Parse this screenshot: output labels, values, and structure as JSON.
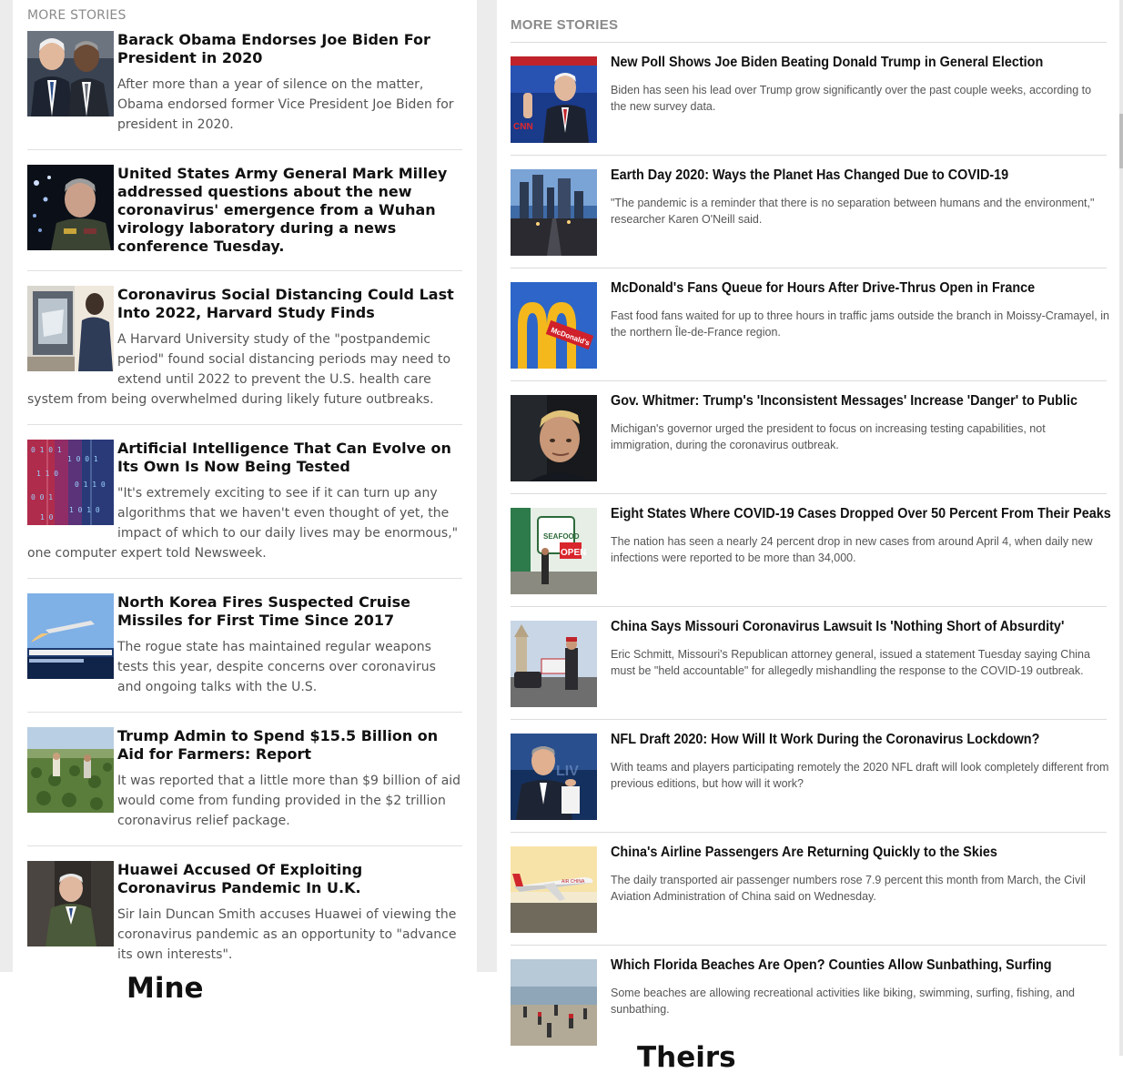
{
  "mine": {
    "header": "MORE STORIES",
    "caption": "Mine",
    "stories": [
      {
        "title": "Barack Obama Endorses Joe Biden For President in 2020",
        "desc": "After more than a year of silence on the matter, Obama endorsed former Vice President Joe Biden for president in 2020."
      },
      {
        "title": "United States Army General Mark Milley addressed questions about the new coronavirus' emergence from a Wuhan virology laboratory during a news conference Tuesday.",
        "desc": ""
      },
      {
        "title": "Coronavirus Social Distancing Could Last Into 2022, Harvard Study Finds",
        "desc": "A Harvard University study of the \"postpandemic period\" found social distancing periods may need to extend until 2022 to prevent the U.S. health care system from being overwhelmed during likely future outbreaks."
      },
      {
        "title": "Artificial Intelligence That Can Evolve on Its Own Is Now Being Tested",
        "desc": "\"It's extremely exciting to see if it can turn up any algorithms that we haven't even thought of yet, the impact of which to our daily lives may be enormous,\" one computer expert told Newsweek."
      },
      {
        "title": "North Korea Fires Suspected Cruise Missiles for First Time Since 2017",
        "desc": "The rogue state has maintained regular weapons tests this year, despite concerns over coronavirus and ongoing talks with the U.S."
      },
      {
        "title": "Trump Admin to Spend $15.5 Billion on Aid for Farmers: Report",
        "desc": "It was reported that a little more than $9 billion of aid would come from funding provided in the $2 trillion coronavirus relief package."
      },
      {
        "title": "Huawei Accused Of Exploiting Coronavirus Pandemic In U.K.",
        "desc": "Sir Iain Duncan Smith accuses Huawei of viewing the coronavirus pandemic as an opportunity to \"advance its own interests\"."
      }
    ]
  },
  "theirs": {
    "header": "MORE STORIES",
    "caption": "Theirs",
    "stories": [
      {
        "title": "New Poll Shows Joe Biden Beating Donald Trump in General Election",
        "desc": "Biden has seen his lead over Trump grow significantly over the past couple weeks, according to the new survey data."
      },
      {
        "title": "Earth Day 2020: Ways the Planet Has Changed Due to COVID-19",
        "desc": "\"The pandemic is a reminder that there is no separation between humans and the environment,\" researcher Karen O'Neill said."
      },
      {
        "title": "McDonald's Fans Queue for Hours After Drive-Thrus Open in France",
        "desc": "Fast food fans waited for up to three hours in traffic jams outside the branch in Moissy-Cramayel, in the northern Île-de-France region."
      },
      {
        "title": "Gov. Whitmer: Trump's 'Inconsistent Messages' Increase 'Danger' to Public",
        "desc": "Michigan's governor urged the president to focus on increasing testing capabilities, not immigration, during the coronavirus outbreak."
      },
      {
        "title": "Eight States Where COVID-19 Cases Dropped Over 50 Percent From Their Peaks",
        "desc": "The nation has seen a nearly 24 percent drop in new cases from around April 4, when daily new infections were reported to be more than 34,000."
      },
      {
        "title": "China Says Missouri Coronavirus Lawsuit Is 'Nothing Short of Absurdity'",
        "desc": "Eric Schmitt, Missouri's Republican attorney general, issued a statement Tuesday saying China must be \"held accountable\" for allegedly mishandling the response to the COVID-19 outbreak."
      },
      {
        "title": "NFL Draft 2020: How Will It Work During the Coronavirus Lockdown?",
        "desc": "With teams and players participating remotely the 2020 NFL draft will look completely different from previous editions, but how will it work?"
      },
      {
        "title": "China's Airline Passengers Are Returning Quickly to the Skies",
        "desc": "The daily transported air passenger numbers rose 7.9 percent this month from March, the Civil Aviation Administration of China said on Wednesday."
      },
      {
        "title": "Which Florida Beaches Are Open? Counties Allow Sunbathing, Surfing",
        "desc": "Some beaches are allowing recreational activities like biking, swimming, surfing, fishing, and sunbathing."
      }
    ]
  }
}
